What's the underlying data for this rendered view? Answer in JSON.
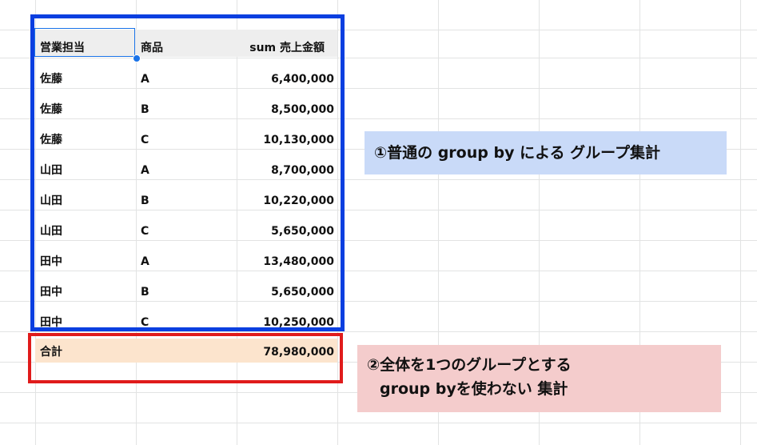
{
  "table": {
    "headers": [
      "営業担当",
      "商品",
      "sum 売上金額"
    ],
    "rows": [
      [
        "佐藤",
        "A",
        "6,400,000"
      ],
      [
        "佐藤",
        "B",
        "8,500,000"
      ],
      [
        "佐藤",
        "C",
        "10,130,000"
      ],
      [
        "山田",
        "A",
        "8,700,000"
      ],
      [
        "山田",
        "B",
        "10,220,000"
      ],
      [
        "山田",
        "C",
        "5,650,000"
      ],
      [
        "田中",
        "A",
        "13,480,000"
      ],
      [
        "田中",
        "B",
        "5,650,000"
      ],
      [
        "田中",
        "C",
        "10,250,000"
      ]
    ],
    "total": {
      "label": "合計",
      "value": "78,980,000"
    }
  },
  "notes": {
    "note1": "①普通の group by による グループ集計",
    "note2_line1": "②全体を1つのグループとする",
    "note2_line2": "group byを使わない 集計"
  },
  "colors": {
    "blue_frame": "#0b3fe0",
    "red_frame": "#e01b1b",
    "note1_bg": "#c9daf8",
    "note2_bg": "#f4cccc",
    "total_row_bg": "#fce4cd",
    "header_bg": "#eeeeee"
  }
}
